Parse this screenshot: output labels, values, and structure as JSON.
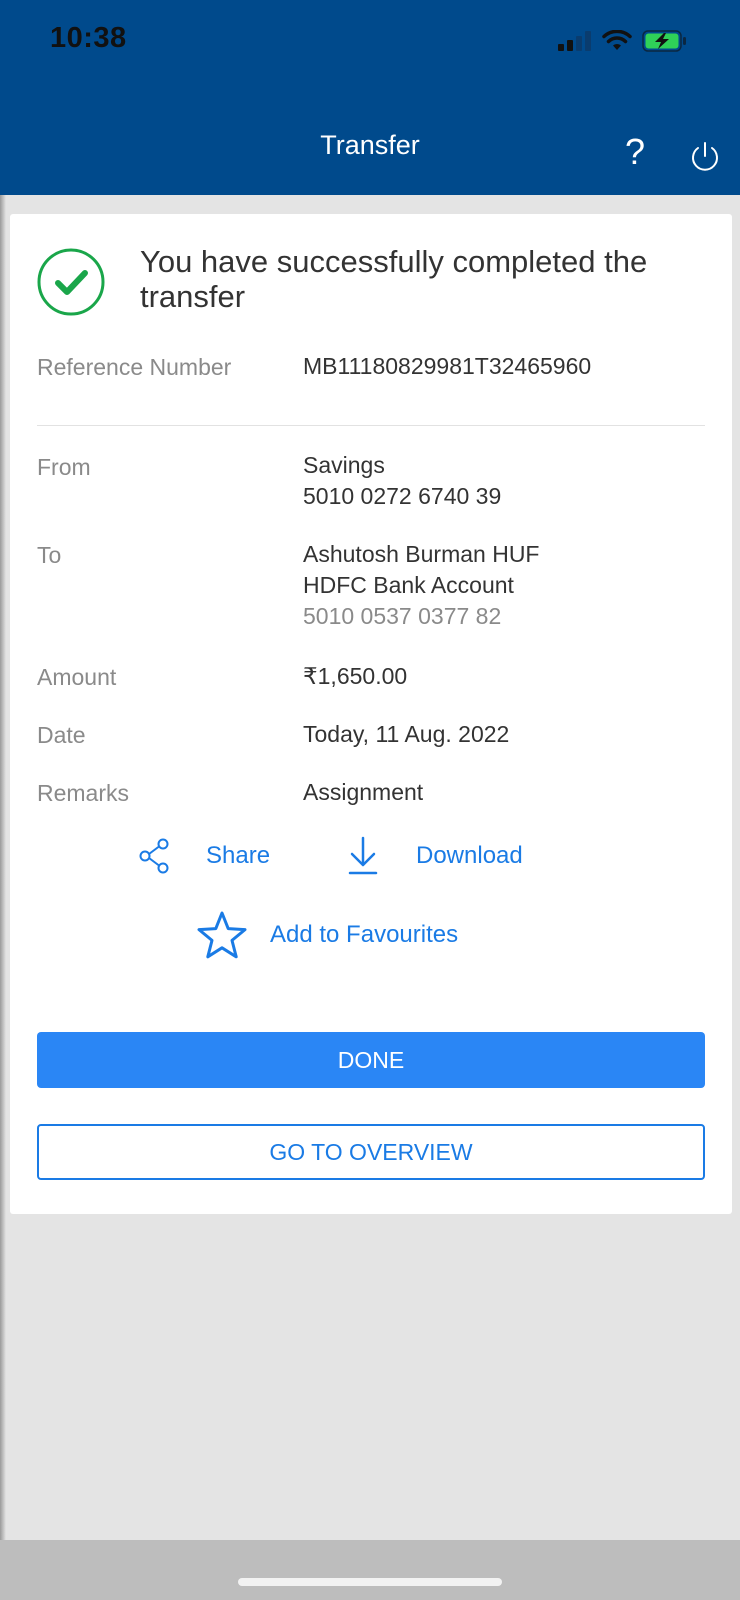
{
  "status_bar": {
    "time": "10:38"
  },
  "header": {
    "title": "Transfer",
    "help_label": "?"
  },
  "success": {
    "message": "You have successfully completed the transfer"
  },
  "details": {
    "reference": {
      "label": "Reference Number",
      "value": "MB11180829981T32465960"
    },
    "from": {
      "label": "From",
      "account_type": "Savings",
      "account_number": "5010 0272 6740 39"
    },
    "to": {
      "label": "To",
      "name": "Ashutosh Burman HUF",
      "bank": "HDFC Bank Account",
      "account_number": "5010 0537 0377 82"
    },
    "amount": {
      "label": "Amount",
      "value": "₹1,650.00"
    },
    "date": {
      "label": "Date",
      "value": "Today, 11 Aug. 2022"
    },
    "remarks": {
      "label": "Remarks",
      "value": "Assignment"
    }
  },
  "actions": {
    "share_label": "Share",
    "download_label": "Download",
    "favourites_label": "Add to Favourites"
  },
  "buttons": {
    "done_label": "DONE",
    "overview_label": "GO TO OVERVIEW"
  },
  "colors": {
    "header_bg": "#004a8c",
    "accent": "#2a86f5",
    "success_green": "#1aa64a"
  }
}
